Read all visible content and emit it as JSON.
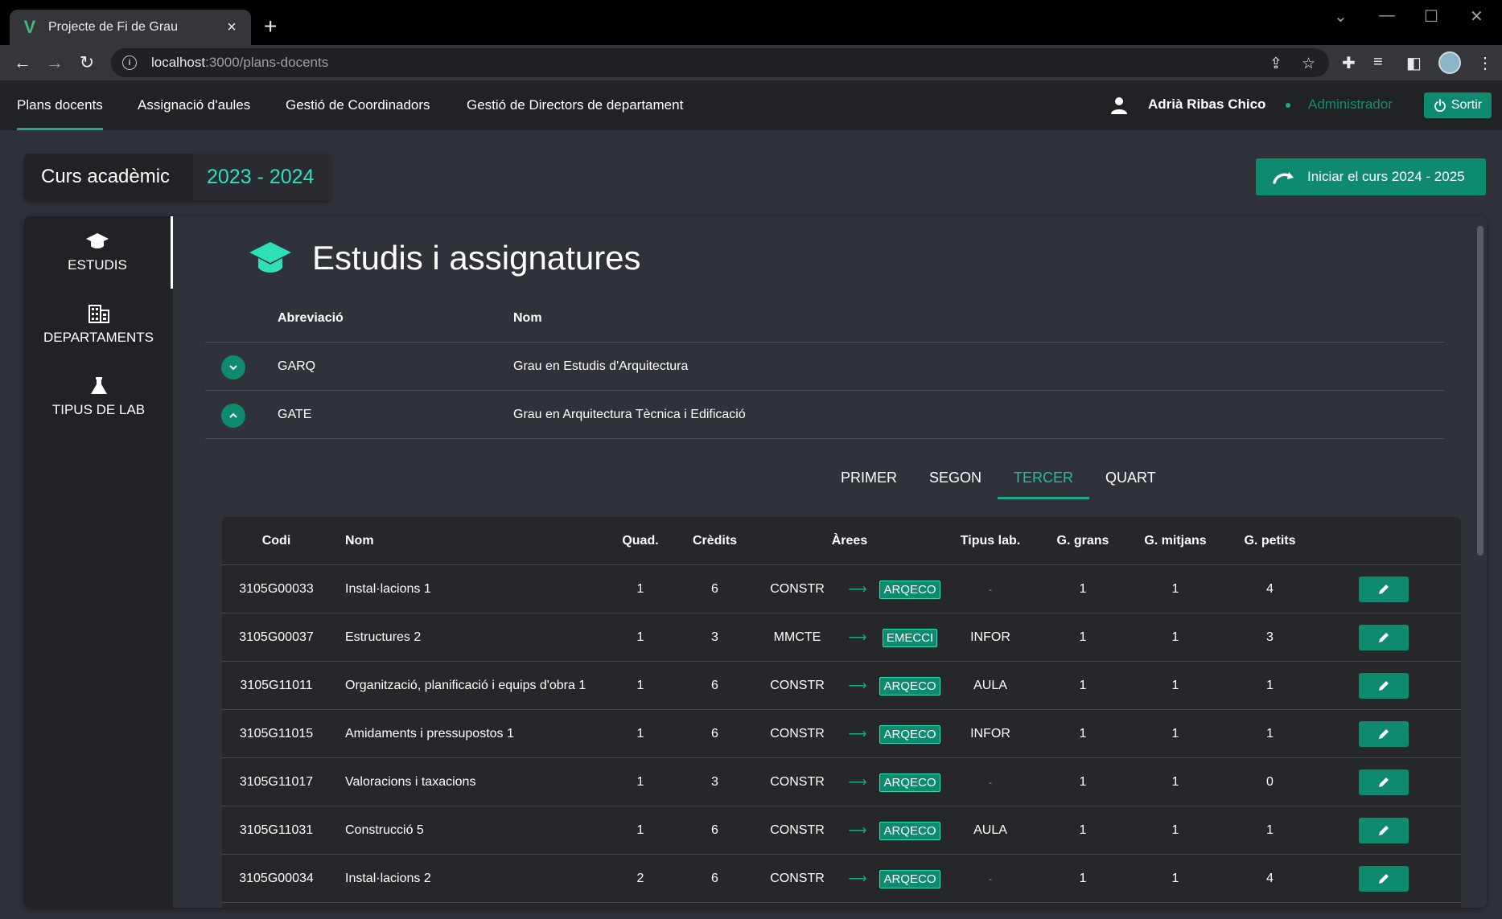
{
  "browser": {
    "tab_title": "Projecte de Fi de Grau",
    "url_host": "localhost",
    "url_path": ":3000/plans-docents"
  },
  "nav": {
    "links": [
      "Plans docents",
      "Assignació d'aules",
      "Gestió de Coordinadors",
      "Gestió de Directors de departament"
    ],
    "user_name": "Adrià Ribas Chico",
    "user_role": "Administrador",
    "logout": "Sortir"
  },
  "course": {
    "label": "Curs acadèmic",
    "year": "2023 - 2024",
    "start_button": "Iniciar el curs 2024 - 2025"
  },
  "sidebar": {
    "items": [
      {
        "label": "ESTUDIS",
        "icon": "graduation-cap-icon"
      },
      {
        "label": "DEPARTAMENTS",
        "icon": "building-icon"
      },
      {
        "label": "TIPUS DE LAB",
        "icon": "flask-icon"
      }
    ]
  },
  "main": {
    "title": "Estudis i assignatures",
    "studies_headers": {
      "abrev": "Abreviació",
      "nom": "Nom"
    },
    "studies": [
      {
        "abrev": "GARQ",
        "nom": "Grau en Estudis d'Arquitectura",
        "expanded": false
      },
      {
        "abrev": "GATE",
        "nom": "Grau en Arquitectura Tècnica i Edificació",
        "expanded": true
      }
    ],
    "year_tabs": [
      "PRIMER",
      "SEGON",
      "TERCER",
      "QUART"
    ],
    "active_tab": "TERCER",
    "table_headers": {
      "codi": "Codi",
      "nom": "Nom",
      "quad": "Quad.",
      "credits": "Crèdits",
      "arees": "Àrees",
      "lab": "Tipus lab.",
      "gg": "G. grans",
      "gm": "G. mitjans",
      "gp": "G. petits"
    },
    "rows": [
      {
        "codi": "3105G00033",
        "nom": "Instal·lacions 1",
        "quad": "1",
        "credits": "6",
        "from": "CONSTR",
        "to": "ARQECO",
        "lab": "-",
        "gg": "1",
        "gm": "1",
        "gp": "4"
      },
      {
        "codi": "3105G00037",
        "nom": "Estructures 2",
        "quad": "1",
        "credits": "3",
        "from": "MMCTE",
        "to": "EMECCI",
        "lab": "INFOR",
        "gg": "1",
        "gm": "1",
        "gp": "3"
      },
      {
        "codi": "3105G11011",
        "nom": "Organització, planificació i equips d'obra 1",
        "quad": "1",
        "credits": "6",
        "from": "CONSTR",
        "to": "ARQECO",
        "lab": "AULA",
        "gg": "1",
        "gm": "1",
        "gp": "1"
      },
      {
        "codi": "3105G11015",
        "nom": "Amidaments i pressupostos 1",
        "quad": "1",
        "credits": "6",
        "from": "CONSTR",
        "to": "ARQECO",
        "lab": "INFOR",
        "gg": "1",
        "gm": "1",
        "gp": "1"
      },
      {
        "codi": "3105G11017",
        "nom": "Valoracions i taxacions",
        "quad": "1",
        "credits": "3",
        "from": "CONSTR",
        "to": "ARQECO",
        "lab": "-",
        "gg": "1",
        "gm": "1",
        "gp": "0"
      },
      {
        "codi": "3105G11031",
        "nom": "Construcció 5",
        "quad": "1",
        "credits": "6",
        "from": "CONSTR",
        "to": "ARQECO",
        "lab": "AULA",
        "gg": "1",
        "gm": "1",
        "gp": "1"
      },
      {
        "codi": "3105G00034",
        "nom": "Instal·lacions 2",
        "quad": "2",
        "credits": "6",
        "from": "CONSTR",
        "to": "ARQECO",
        "lab": "-",
        "gg": "1",
        "gm": "1",
        "gp": "4"
      }
    ]
  },
  "colors": {
    "accent": "#0e8a6f",
    "accent_light": "#2de0b8",
    "background": "#2f3238",
    "panel": "#212226"
  }
}
